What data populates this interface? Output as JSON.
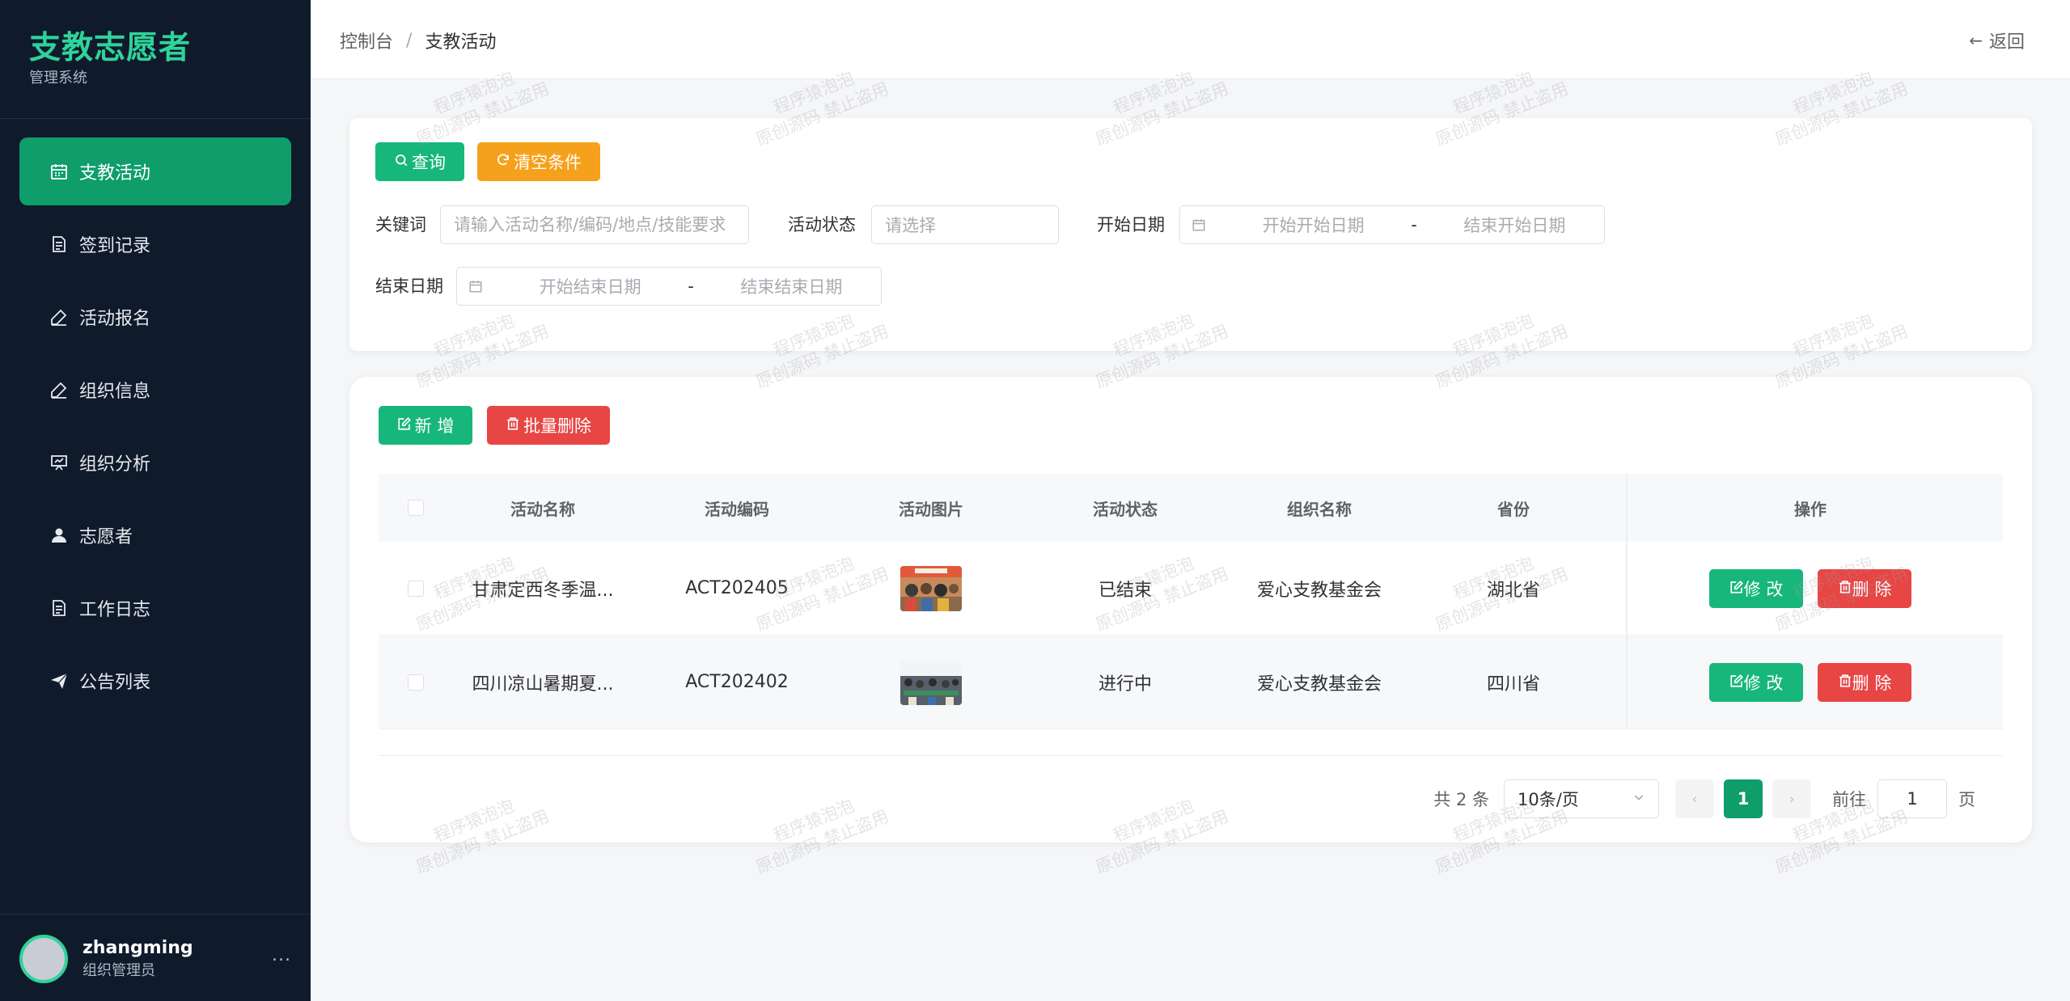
{
  "sidebar": {
    "brand_title": "支教志愿者",
    "brand_subtitle": "管理系统",
    "items": [
      {
        "label": "支教活动",
        "icon": "calendar-icon",
        "active": true
      },
      {
        "label": "签到记录",
        "icon": "document-icon",
        "active": false
      },
      {
        "label": "活动报名",
        "icon": "edit-icon",
        "active": false
      },
      {
        "label": "组织信息",
        "icon": "edit-icon",
        "active": false
      },
      {
        "label": "组织分析",
        "icon": "presentation-icon",
        "active": false
      },
      {
        "label": "志愿者",
        "icon": "user-icon",
        "active": false
      },
      {
        "label": "工作日志",
        "icon": "document-icon",
        "active": false
      },
      {
        "label": "公告列表",
        "icon": "send-icon",
        "active": false
      }
    ],
    "user": {
      "name": "zhangming",
      "role": "组织管理员",
      "more": "..."
    }
  },
  "header": {
    "breadcrumb": [
      "控制台",
      "支教活动"
    ],
    "breadcrumb_sep": "/",
    "back_label": "返回"
  },
  "search": {
    "query_label": "查询",
    "clear_label": "清空条件",
    "keyword_label": "关键词",
    "keyword_placeholder": "请输入活动名称/编码/地点/技能要求",
    "status_label": "活动状态",
    "status_placeholder": "请选择",
    "start_date_label": "开始日期",
    "start_from_placeholder": "开始开始日期",
    "start_to_placeholder": "结束开始日期",
    "end_date_label": "结束日期",
    "end_from_placeholder": "开始结束日期",
    "end_to_placeholder": "结束结束日期",
    "range_sep": "-"
  },
  "toolbar": {
    "add_label": "新 增",
    "batch_delete_label": "批量删除"
  },
  "table": {
    "columns": [
      "活动名称",
      "活动编码",
      "活动图片",
      "活动状态",
      "组织名称",
      "省份",
      "操作"
    ],
    "rows": [
      {
        "name": "甘肃定西冬季温...",
        "code": "ACT202405",
        "status": "已结束",
        "org": "爱心支教基金会",
        "province": "湖北省",
        "edit": "修 改",
        "delete": "删 除"
      },
      {
        "name": "四川凉山暑期夏...",
        "code": "ACT202402",
        "status": "进行中",
        "org": "爱心支教基金会",
        "province": "四川省",
        "edit": "修 改",
        "delete": "删 除"
      }
    ]
  },
  "pagination": {
    "total": "共 2 条",
    "page_size": "10条/页",
    "current_page": "1",
    "goto_label": "前往",
    "goto_value": "1",
    "page_suffix": "页"
  },
  "watermark": {
    "line1": "程序猿泡泡",
    "line2": "原创源码 禁止盗用"
  },
  "colors": {
    "sidebar_bg": "#0f1a2b",
    "brand": "#2fd39a",
    "primary": "#0e9d6b",
    "success_button": "#17b77b",
    "warning_button": "#f6a11c",
    "danger_button": "#e84545"
  }
}
